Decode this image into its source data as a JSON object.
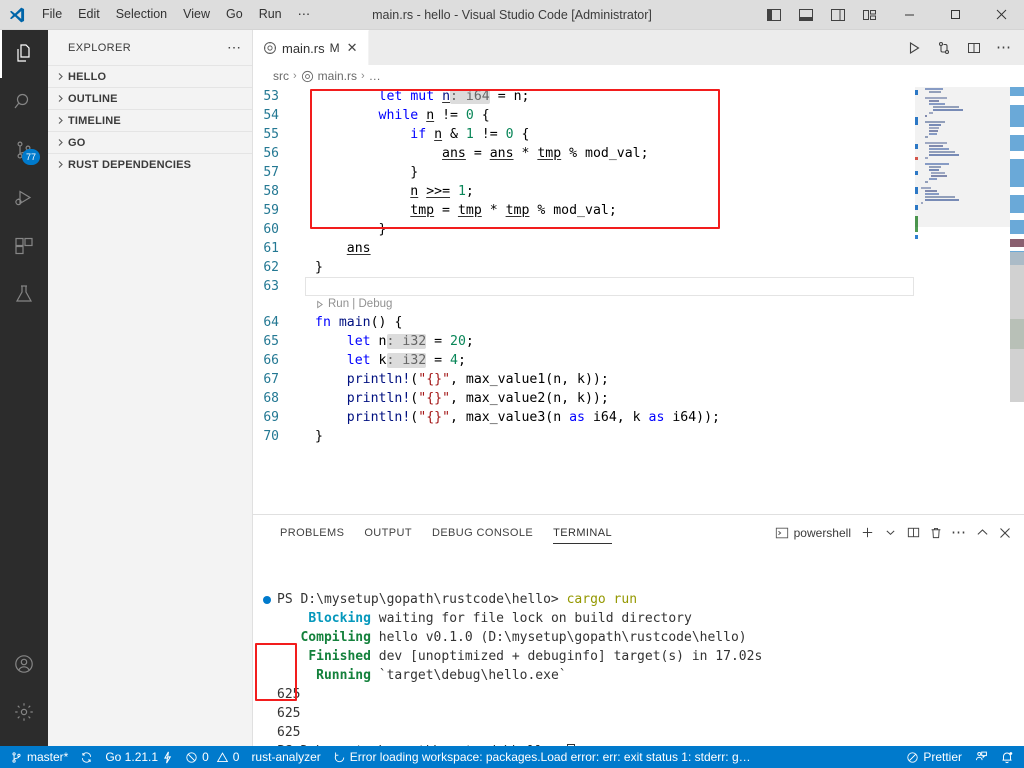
{
  "window": {
    "title": "main.rs - hello - Visual Studio Code [Administrator]",
    "logo_icon": "vscode-logo-icon",
    "menus": [
      {
        "label": "File"
      },
      {
        "label": "Edit"
      },
      {
        "label": "Selection"
      },
      {
        "label": "View"
      },
      {
        "label": "Go"
      },
      {
        "label": "Run"
      },
      {
        "label": "⋯"
      }
    ],
    "layout_buttons": [
      {
        "name": "toggle-primary-sidebar-icon"
      },
      {
        "name": "toggle-panel-icon"
      },
      {
        "name": "toggle-secondary-sidebar-icon"
      },
      {
        "name": "customize-layout-icon"
      }
    ],
    "controls": {
      "minimize": "─",
      "maximize": "☐",
      "close": "✕"
    }
  },
  "activitybar": {
    "items": [
      {
        "name": "explorer",
        "icon": "files-icon",
        "active": true,
        "badge": ""
      },
      {
        "name": "search",
        "icon": "search-icon",
        "active": false,
        "badge": ""
      },
      {
        "name": "source-control",
        "icon": "source-control-icon",
        "active": false,
        "badge": "77"
      },
      {
        "name": "run-and-debug",
        "icon": "run-debug-icon",
        "active": false,
        "badge": ""
      },
      {
        "name": "extensions",
        "icon": "extensions-icon",
        "active": false,
        "badge": ""
      },
      {
        "name": "testing",
        "icon": "beaker-icon",
        "active": false,
        "badge": ""
      }
    ],
    "bottom": [
      {
        "name": "accounts",
        "icon": "account-icon"
      },
      {
        "name": "manage",
        "icon": "gear-icon"
      }
    ]
  },
  "sidebar": {
    "title": "EXPLORER",
    "more_actions": "⋯",
    "sections": [
      {
        "label": "HELLO",
        "expanded": false
      },
      {
        "label": "OUTLINE",
        "expanded": false
      },
      {
        "label": "TIMELINE",
        "expanded": false
      },
      {
        "label": "GO",
        "expanded": false
      },
      {
        "label": "RUST DEPENDENCIES",
        "expanded": false
      }
    ]
  },
  "editor": {
    "tab": {
      "filename": "main.rs",
      "modified_badge": "M",
      "close": "✕",
      "icon": "rust-file-icon"
    },
    "tab_actions": [
      {
        "name": "run-code-button",
        "icon": "play-icon"
      },
      {
        "name": "source-control-graph-button",
        "icon": "git-graph-icon"
      },
      {
        "name": "split-editor-button",
        "icon": "split-editor-icon"
      },
      {
        "name": "more-actions-button",
        "icon": "ellipsis-icon"
      }
    ],
    "breadcrumbs": [
      "src",
      "main.rs",
      "…"
    ],
    "codelens": {
      "run": "Run",
      "sep": "|",
      "debug": "Debug"
    },
    "first_line_number": 53,
    "lines": [
      {
        "n": 53,
        "gutter": "dirty",
        "tokens": [
          {
            "t": "        ",
            "c": "plain"
          },
          {
            "t": "let",
            "c": "kw"
          },
          {
            "t": " ",
            "c": "plain"
          },
          {
            "t": "mut",
            "c": "kw"
          },
          {
            "t": " ",
            "c": "plain"
          },
          {
            "t": "n",
            "c": "id und"
          },
          {
            "t": ": i64",
            "c": "hint"
          },
          {
            "t": " = ",
            "c": "plain"
          },
          {
            "t": "n",
            "c": "plain"
          },
          {
            "t": ";",
            "c": "plain"
          }
        ]
      },
      {
        "n": 54,
        "gutter": "dirty",
        "tokens": [
          {
            "t": "        ",
            "c": "plain"
          },
          {
            "t": "while",
            "c": "kw"
          },
          {
            "t": " ",
            "c": "plain"
          },
          {
            "t": "n",
            "c": "plain und"
          },
          {
            "t": " != ",
            "c": "plain"
          },
          {
            "t": "0",
            "c": "num"
          },
          {
            "t": " {",
            "c": "plain"
          }
        ]
      },
      {
        "n": 55,
        "gutter": "dirty",
        "tokens": [
          {
            "t": "            ",
            "c": "plain"
          },
          {
            "t": "if",
            "c": "kw"
          },
          {
            "t": " ",
            "c": "plain"
          },
          {
            "t": "n",
            "c": "plain und"
          },
          {
            "t": " & ",
            "c": "plain"
          },
          {
            "t": "1",
            "c": "num"
          },
          {
            "t": " != ",
            "c": "plain"
          },
          {
            "t": "0",
            "c": "num"
          },
          {
            "t": " {",
            "c": "plain"
          }
        ]
      },
      {
        "n": 56,
        "gutter": "dirty",
        "tokens": [
          {
            "t": "                ",
            "c": "plain"
          },
          {
            "t": "ans",
            "c": "plain und"
          },
          {
            "t": " = ",
            "c": "plain"
          },
          {
            "t": "ans",
            "c": "plain und"
          },
          {
            "t": " * ",
            "c": "plain"
          },
          {
            "t": "tmp",
            "c": "plain und"
          },
          {
            "t": " % mod_val;",
            "c": "plain"
          }
        ]
      },
      {
        "n": 57,
        "gutter": "dirty",
        "tokens": [
          {
            "t": "            }",
            "c": "plain"
          }
        ]
      },
      {
        "n": 58,
        "gutter": "dirty",
        "tokens": [
          {
            "t": "            ",
            "c": "plain"
          },
          {
            "t": "n",
            "c": "plain und"
          },
          {
            "t": " ",
            "c": "plain"
          },
          {
            "t": ">>=",
            "c": "plain und"
          },
          {
            "t": " ",
            "c": "plain"
          },
          {
            "t": "1",
            "c": "num"
          },
          {
            "t": ";",
            "c": "plain"
          }
        ]
      },
      {
        "n": 59,
        "gutter": "dirty",
        "tokens": [
          {
            "t": "            ",
            "c": "plain"
          },
          {
            "t": "tmp",
            "c": "plain und"
          },
          {
            "t": " = ",
            "c": "plain"
          },
          {
            "t": "tmp",
            "c": "plain und"
          },
          {
            "t": " * ",
            "c": "plain"
          },
          {
            "t": "tmp",
            "c": "plain und"
          },
          {
            "t": " % mod_val;",
            "c": "plain"
          }
        ]
      },
      {
        "n": 60,
        "gutter": "none",
        "tokens": [
          {
            "t": "        }",
            "c": "plain"
          }
        ]
      },
      {
        "n": 61,
        "gutter": "dirty",
        "tokens": [
          {
            "t": "    ",
            "c": "plain"
          },
          {
            "t": "ans",
            "c": "plain und"
          }
        ]
      },
      {
        "n": 62,
        "gutter": "none",
        "tokens": [
          {
            "t": "}",
            "c": "plain"
          }
        ]
      },
      {
        "n": 63,
        "gutter": "none",
        "tokens": [
          {
            "t": "",
            "c": "plain"
          }
        ]
      },
      {
        "n": 64,
        "gutter": "added",
        "tokens": [
          {
            "t": "fn",
            "c": "kw"
          },
          {
            "t": " ",
            "c": "plain"
          },
          {
            "t": "main",
            "c": "id"
          },
          {
            "t": "()",
            "c": "plain"
          },
          {
            "t": " {",
            "c": "plain"
          }
        ]
      },
      {
        "n": 65,
        "gutter": "added",
        "tokens": [
          {
            "t": "    ",
            "c": "plain"
          },
          {
            "t": "let",
            "c": "kw"
          },
          {
            "t": " ",
            "c": "plain"
          },
          {
            "t": "n",
            "c": "plain"
          },
          {
            "t": ": i32",
            "c": "hint"
          },
          {
            "t": " = ",
            "c": "plain"
          },
          {
            "t": "20",
            "c": "num"
          },
          {
            "t": ";",
            "c": "plain"
          }
        ]
      },
      {
        "n": 66,
        "gutter": "added",
        "tokens": [
          {
            "t": "    ",
            "c": "plain"
          },
          {
            "t": "let",
            "c": "kw"
          },
          {
            "t": " ",
            "c": "plain"
          },
          {
            "t": "k",
            "c": "plain"
          },
          {
            "t": ": i32",
            "c": "hint"
          },
          {
            "t": " = ",
            "c": "plain"
          },
          {
            "t": "4",
            "c": "num"
          },
          {
            "t": ";",
            "c": "plain"
          }
        ]
      },
      {
        "n": 67,
        "gutter": "added",
        "tokens": [
          {
            "t": "    ",
            "c": "plain"
          },
          {
            "t": "println!",
            "c": "id"
          },
          {
            "t": "(",
            "c": "plain"
          },
          {
            "t": "\"{}\"",
            "c": "str"
          },
          {
            "t": ", max_value1(n, k));",
            "c": "plain"
          }
        ]
      },
      {
        "n": 68,
        "gutter": "added",
        "tokens": [
          {
            "t": "    ",
            "c": "plain"
          },
          {
            "t": "println!",
            "c": "id"
          },
          {
            "t": "(",
            "c": "plain"
          },
          {
            "t": "\"{}\"",
            "c": "str"
          },
          {
            "t": ", max_value2(n, k));",
            "c": "plain"
          }
        ]
      },
      {
        "n": 69,
        "gutter": "added",
        "tokens": [
          {
            "t": "    ",
            "c": "plain"
          },
          {
            "t": "println!",
            "c": "id"
          },
          {
            "t": "(",
            "c": "plain"
          },
          {
            "t": "\"{}\"",
            "c": "str"
          },
          {
            "t": ", max_value3(n ",
            "c": "plain"
          },
          {
            "t": "as",
            "c": "kw"
          },
          {
            "t": " i64, k ",
            "c": "plain"
          },
          {
            "t": "as",
            "c": "kw"
          },
          {
            "t": " i64));",
            "c": "plain"
          }
        ]
      },
      {
        "n": 70,
        "gutter": "added",
        "tokens": [
          {
            "t": "}",
            "c": "plain"
          }
        ]
      }
    ],
    "annotation_color": "#f21d1d"
  },
  "panel": {
    "tabs": [
      {
        "label": "PROBLEMS",
        "active": false
      },
      {
        "label": "OUTPUT",
        "active": false
      },
      {
        "label": "DEBUG CONSOLE",
        "active": false
      },
      {
        "label": "TERMINAL",
        "active": true
      }
    ],
    "terminal_name": "powershell",
    "actions": [
      {
        "name": "new-terminal-button",
        "icon": "plus-icon"
      },
      {
        "name": "terminal-profile-dropdown",
        "icon": "chevron-down-icon"
      },
      {
        "name": "split-terminal-button",
        "icon": "split-icon"
      },
      {
        "name": "kill-terminal-button",
        "icon": "trash-icon"
      },
      {
        "name": "panel-more-actions-button",
        "icon": "ellipsis-icon"
      },
      {
        "name": "maximize-panel-button",
        "icon": "chevron-up-icon"
      },
      {
        "name": "close-panel-button",
        "icon": "close-icon"
      }
    ],
    "terminal_lines": [
      {
        "marker": "filled",
        "segments": [
          {
            "t": "PS D:\\mysetup\\gopath\\rustcode\\hello> ",
            "c": "tc-plain"
          },
          {
            "t": "cargo run",
            "c": "tc-yellow"
          }
        ]
      },
      {
        "marker": "none",
        "segments": [
          {
            "t": "    ",
            "c": "tc-plain"
          },
          {
            "t": "Blocking",
            "c": "tc-cyan"
          },
          {
            "t": " waiting for file lock on build directory",
            "c": "tc-plain"
          }
        ]
      },
      {
        "marker": "none",
        "segments": [
          {
            "t": "   ",
            "c": "tc-plain"
          },
          {
            "t": "Compiling",
            "c": "tc-green"
          },
          {
            "t": " hello v0.1.0 (D:\\mysetup\\gopath\\rustcode\\hello)",
            "c": "tc-plain"
          }
        ]
      },
      {
        "marker": "none",
        "segments": [
          {
            "t": "    ",
            "c": "tc-plain"
          },
          {
            "t": "Finished",
            "c": "tc-green"
          },
          {
            "t": " dev [unoptimized + debuginfo] target(s) in 17.02s",
            "c": "tc-plain"
          }
        ]
      },
      {
        "marker": "none",
        "segments": [
          {
            "t": "     ",
            "c": "tc-plain"
          },
          {
            "t": "Running",
            "c": "tc-green"
          },
          {
            "t": " `target\\debug\\hello.exe`",
            "c": "tc-plain"
          }
        ]
      },
      {
        "marker": "none",
        "segments": [
          {
            "t": "625",
            "c": "tc-plain"
          }
        ]
      },
      {
        "marker": "none",
        "segments": [
          {
            "t": "625",
            "c": "tc-plain"
          }
        ]
      },
      {
        "marker": "none",
        "segments": [
          {
            "t": "625",
            "c": "tc-plain"
          }
        ]
      },
      {
        "marker": "hollow",
        "segments": [
          {
            "t": "PS D:\\mysetup\\gopath\\rustcode\\hello> ",
            "c": "tc-plain"
          }
        ],
        "cursor": true
      }
    ]
  },
  "statusbar": {
    "branch": "master*",
    "branch_icon": "source-control-branch-icon",
    "sync_icon": "sync-icon",
    "go_version": "Go 1.21.1",
    "go_icon": "go-lightning-icon",
    "errors": "0",
    "warnings": "0",
    "error_icon": "error-circle-icon",
    "warning_icon": "warning-triangle-icon",
    "rust_analyzer": "rust-analyzer",
    "loading_icon": "loading-spinner-icon",
    "error_message": "Error loading workspace: packages.Load error: err: exit status 1: stderr: g…",
    "prettier": "Prettier",
    "prettier_icon": "prettier-disabled-icon",
    "remote_icon": "remote-feedback-icon",
    "bell_icon": "bell-dot-icon",
    "background": "#007acc"
  }
}
